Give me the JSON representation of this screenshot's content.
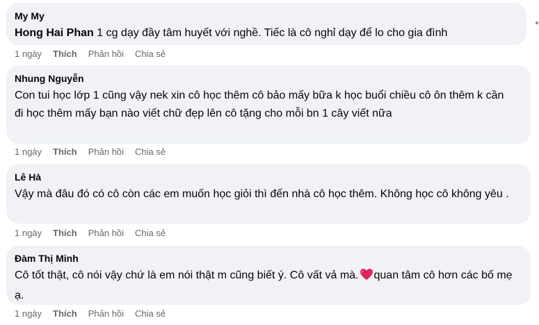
{
  "comments": [
    {
      "author": "My My",
      "mention": "Hong Hai Phan",
      "text": " 1 cg dạy đầy tâm huyết với nghề. Tiếc là cô nghỉ dạy để lo cho gia đình",
      "time": "1 ngày",
      "like": "Thích",
      "reply": "Phản hồi",
      "share": "Chia sẻ"
    },
    {
      "author": "Nhung Nguyễn",
      "text": "Con tui học lớp 1 cũng vậy nek xin cô học thêm cô bảo mấy bữa k học buổi chiều cô ôn thêm k cần đi học thêm mấy bạn nào viết chữ đẹp lên cô tặng cho mỗi bn 1 cây viết nữa",
      "time": "1 ngày",
      "like": "Thích",
      "reply": "Phản hồi",
      "share": "Chia sẻ"
    },
    {
      "author": "Lê Hà",
      "text": "Vậy mà đâu đó có cô còn các em muốn học giỏi thì đến nhà cô học thêm. Không học cô không yêu .",
      "time": "1 ngày",
      "like": "Thích",
      "reply": "Phản hồi",
      "share": "Chia sẻ"
    },
    {
      "author": "Đàm Thị Minh",
      "text_before": "Cô tốt thật, cô nói vậy chứ là em nói thật m cũng biết ý. Cô vất vả mà.",
      "emoji": "heart-emoji",
      "text_after": "quan tâm cô hơn các bố mẹ ạ.",
      "time": "1 ngày",
      "like": "Thích",
      "reply": "Phản hồi",
      "share": "Chia sẻ"
    }
  ],
  "colors": {
    "bubble": "#f0f2f5",
    "text": "#050505",
    "meta": "#65676b",
    "heart": "#e0245e"
  }
}
